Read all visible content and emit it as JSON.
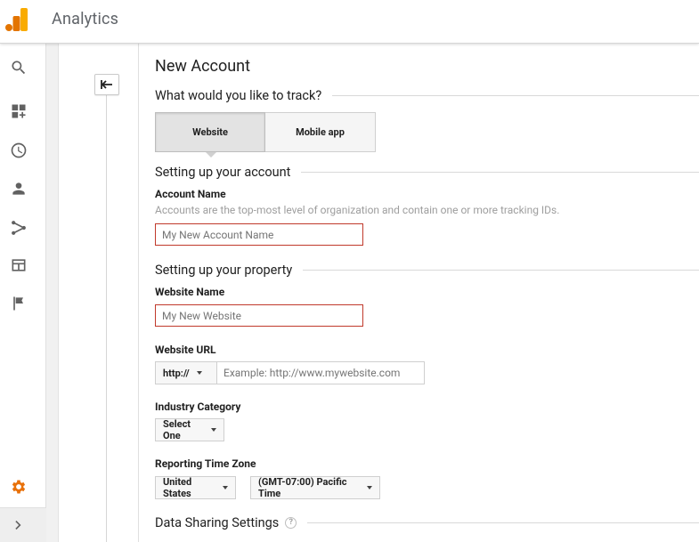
{
  "app": {
    "title": "Analytics"
  },
  "nav": {
    "icons": [
      "search-icon",
      "customization-icon",
      "realtime-icon",
      "audience-icon",
      "acquisition-icon",
      "behavior-icon",
      "conversions-icon",
      "admin-gear-icon",
      "expand-chevron-icon"
    ]
  },
  "form": {
    "title": "New Account",
    "track_question": "What would you like to track?",
    "track_options": [
      {
        "label": "Website",
        "selected": true
      },
      {
        "label": "Mobile app",
        "selected": false
      }
    ],
    "account_section": "Setting up your account",
    "account_name_label": "Account Name",
    "account_name_help": "Accounts are the top-most level of organization and contain one or more tracking IDs.",
    "account_name_placeholder": "My New Account Name",
    "property_section": "Setting up your property",
    "website_name_label": "Website Name",
    "website_name_placeholder": "My New Website",
    "website_url_label": "Website URL",
    "protocol_value": "http://",
    "website_url_placeholder": "Example: http://www.mywebsite.com",
    "industry_label": "Industry Category",
    "industry_value": "Select One",
    "timezone_label": "Reporting Time Zone",
    "country_value": "United States",
    "timezone_value": "(GMT-07:00) Pacific Time",
    "data_sharing_section": "Data Sharing Settings",
    "help_glyph": "?"
  },
  "colors": {
    "accent_orange": "#e8710a",
    "error_border": "#c0392b",
    "logo_yellow": "#f9ab00",
    "logo_orange": "#e37400"
  }
}
